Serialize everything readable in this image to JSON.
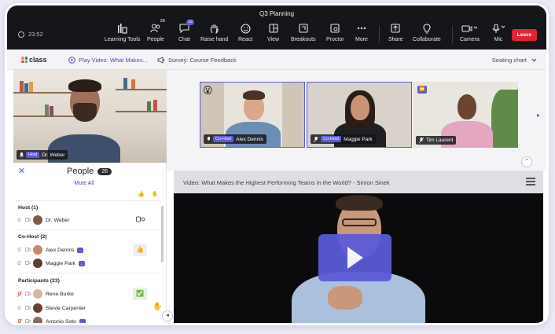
{
  "window": {
    "title": "Q3 Planning"
  },
  "timer": {
    "value": "23:52"
  },
  "toolbar": {
    "items": [
      {
        "label": "Learning Tools",
        "icon": "learning-tools-icon"
      },
      {
        "label": "People",
        "icon": "people-icon",
        "badge": "26"
      },
      {
        "label": "Chat",
        "icon": "chat-icon",
        "badge": "12"
      },
      {
        "label": "Raise hand",
        "icon": "raise-hand-icon"
      },
      {
        "label": "React",
        "icon": "react-icon"
      },
      {
        "label": "View",
        "icon": "view-icon"
      },
      {
        "label": "Breakouts",
        "icon": "breakouts-icon"
      },
      {
        "label": "Proctor",
        "icon": "proctor-icon"
      },
      {
        "label": "More",
        "icon": "more-icon"
      },
      {
        "label": "Share",
        "icon": "share-icon"
      },
      {
        "label": "Collaborate",
        "icon": "collaborate-icon"
      },
      {
        "label": "Camera",
        "icon": "camera-icon"
      },
      {
        "label": "Mic",
        "icon": "mic-icon"
      }
    ],
    "leave_label": "Leave"
  },
  "subbar": {
    "logo": "class",
    "tabs": [
      {
        "label": "Play Video: What Makes...",
        "icon": "play-circle-icon"
      },
      {
        "label": "Survey: Course Feedback",
        "icon": "megaphone-icon"
      }
    ],
    "seating_chart": "Seating chart"
  },
  "host_video": {
    "role": "Host",
    "name": "Dr. Weber"
  },
  "stage": {
    "tiles": [
      {
        "role": "Co-Host",
        "name": "Alex Dennis",
        "reaction": "😮"
      },
      {
        "role": "Co-Host",
        "name": "Maggie Park"
      },
      {
        "role": "",
        "name": "Tim Laurent"
      }
    ]
  },
  "people": {
    "title": "People",
    "count": "26",
    "mute_all": "Mute All",
    "sections": [
      {
        "label": "Host (1)",
        "members": [
          {
            "name": "Dr. Weber"
          }
        ]
      },
      {
        "label": "Co-Host (2)",
        "members": [
          {
            "name": "Alex Dennis"
          },
          {
            "name": "Maggie Park"
          }
        ]
      },
      {
        "label": "Participants (23)",
        "members": [
          {
            "name": "Rene Burke"
          },
          {
            "name": "Stevie Carpenter"
          },
          {
            "name": "Antonio Soto"
          }
        ]
      }
    ]
  },
  "video": {
    "title": "Video: What Makes the Highest Performing Teams in the World? - Simon Sinek"
  },
  "colors": {
    "accent": "#5b5bd6",
    "leave": "#e02434",
    "toolbar_bg": "#15161a"
  }
}
